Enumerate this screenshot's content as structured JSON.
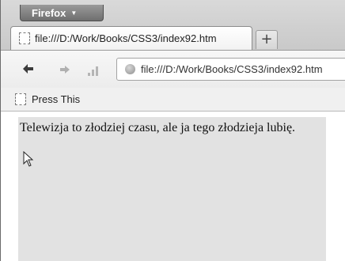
{
  "app": {
    "menu_button_label": "Firefox",
    "menu_button_arrow": "▼"
  },
  "tabs": [
    {
      "label": "file:///D:/Work/Books/CSS3/index92.htm",
      "icon": "blank-page-icon"
    }
  ],
  "new_tab_label": "+",
  "navigation": {
    "back_icon": "back-arrow-icon",
    "forward_icon": "forward-arrow-icon",
    "signal_icon": "signal-bars-icon",
    "url": "file:///D:/Work/Books/CSS3/index92.htm"
  },
  "bookmarks": [
    {
      "label": "Press This",
      "icon": "blank-page-icon"
    }
  ],
  "content": {
    "text": "Telewizja to złodziej czasu, ale ja tego złodzieja lubię."
  },
  "colors": {
    "content_box_background": "#e2e2e2",
    "menu_button_background": "#7f7f7f"
  }
}
